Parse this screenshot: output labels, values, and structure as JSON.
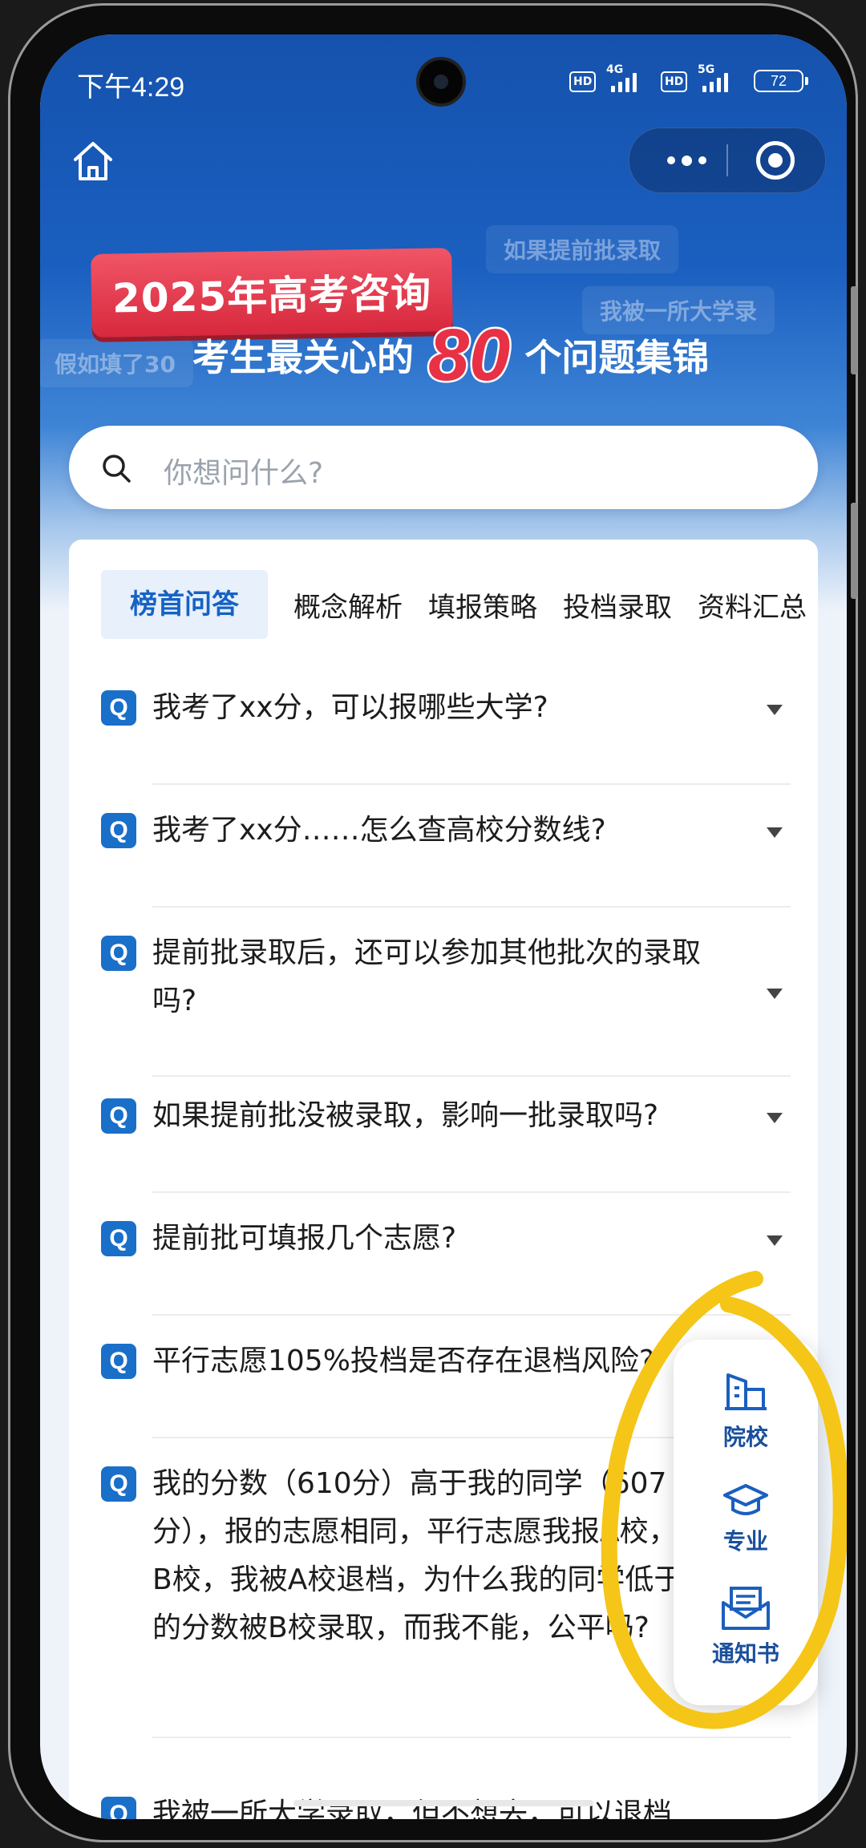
{
  "status": {
    "time": "下午4:29",
    "net1": "4G",
    "net2": "5G",
    "hd": "HD",
    "battery": "72"
  },
  "banner": {
    "title": "2025年高考咨询",
    "subtitle_pre": "考生最关心的",
    "subtitle_num": "80",
    "subtitle_post": "个问题集锦",
    "bubbles": [
      "如果提前批录取",
      "我被一所大学录",
      "假如填了30"
    ]
  },
  "search": {
    "placeholder": "你想问什么?"
  },
  "tabs": [
    "榜首问答",
    "概念解析",
    "填报策略",
    "投档录取",
    "资料汇总"
  ],
  "questions": [
    "我考了xx分，可以报哪些大学?",
    "我考了xx分……怎么查高校分数线?",
    "提前批录取后，还可以参加其他批次的录取吗?",
    "如果提前批没被录取，影响一批录取吗?",
    "提前批可填报几个志愿?",
    "平行志愿105%投档是否存在退档风险?",
    "我的分数（610分）高于我的同学（607分），报的志愿相同，平行志愿我报A校，他报B校，我被A校退档，为什么我的同学低于我的分数被B校录取，而我不能，公平吗?",
    "我被一所大学录取，但不想去，可以退档"
  ],
  "q_icon": "Q",
  "float_menu": [
    {
      "label": "院校",
      "icon": "building-icon"
    },
    {
      "label": "专业",
      "icon": "graduation-cap-icon"
    },
    {
      "label": "通知书",
      "icon": "letter-icon"
    }
  ],
  "colors": {
    "primary": "#1a5fc0",
    "accent_red": "#e83145",
    "highlight_ink": "#f5c518"
  }
}
